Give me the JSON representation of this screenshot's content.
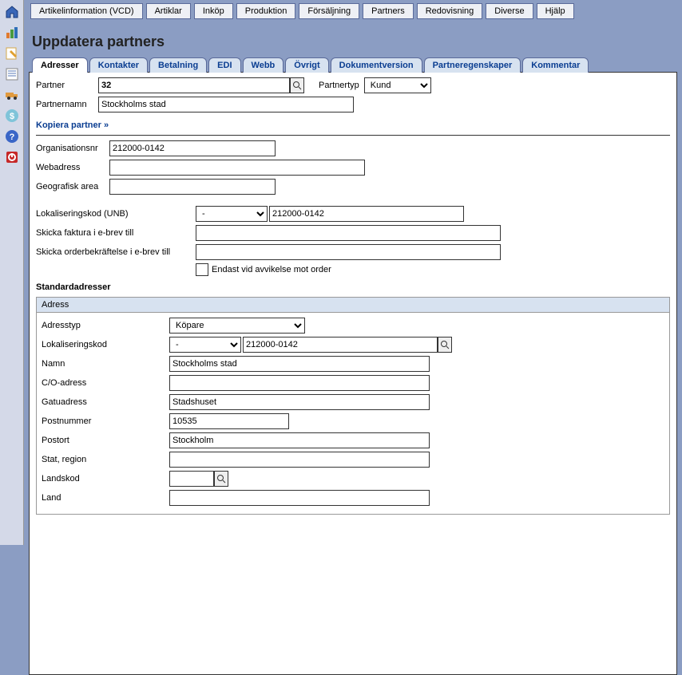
{
  "topnav": [
    "Artikelinformation (VCD)",
    "Artiklar",
    "Inköp",
    "Produktion",
    "Försäljning",
    "Partners",
    "Redovisning",
    "Diverse",
    "Hjälp"
  ],
  "page_title": "Uppdatera partners",
  "tabs": [
    "Adresser",
    "Kontakter",
    "Betalning",
    "EDI",
    "Webb",
    "Övrigt",
    "Dokumentversion",
    "Partneregenskaper",
    "Kommentar"
  ],
  "active_tab": 0,
  "header": {
    "partner_label": "Partner",
    "partner_value": "32",
    "partnertyp_label": "Partnertyp",
    "partnertyp_value": "Kund",
    "partnernamn_label": "Partnernamn",
    "partnernamn_value": "Stockholms stad",
    "copy_link": "Kopiera partner »"
  },
  "fields": {
    "orgnr_label": "Organisationsnr",
    "orgnr_value": "212000-0142",
    "webadress_label": "Webadress",
    "webadress_value": "",
    "geoarea_label": "Geografisk area",
    "geoarea_value": "",
    "unb_label": "Lokaliseringskod (UNB)",
    "unb_sel": "-",
    "unb_value": "212000-0142",
    "faktura_label": "Skicka faktura i e-brev till",
    "faktura_value": "",
    "orderbek_label": "Skicka orderbekräftelse i e-brev till",
    "orderbek_value": "",
    "avvikelse_label": "Endast vid avvikelse mot order"
  },
  "stdadr_heading": "Standardadresser",
  "address": {
    "box_title": "Adress",
    "addresstyp_label": "Adresstyp",
    "addresstyp_value": "Köpare",
    "lokkod_label": "Lokaliseringskod",
    "lokkod_sel": "-",
    "lokkod_value": "212000-0142",
    "namn_label": "Namn",
    "namn_value": "Stockholms stad",
    "co_label": "C/O-adress",
    "co_value": "",
    "gatu_label": "Gatuadress",
    "gatu_value": "Stadshuset",
    "postnr_label": "Postnummer",
    "postnr_value": "10535",
    "postort_label": "Postort",
    "postort_value": "Stockholm",
    "stat_label": "Stat, region",
    "stat_value": "",
    "landskod_label": "Landskod",
    "landskod_value": "",
    "land_label": "Land",
    "land_value": ""
  }
}
